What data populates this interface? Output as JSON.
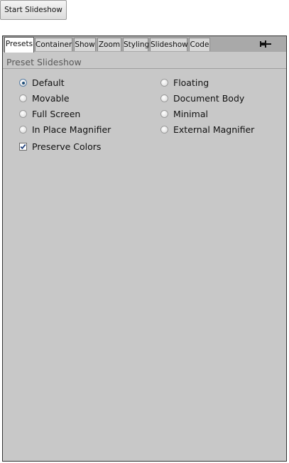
{
  "start_button": {
    "label": "Start Slideshow"
  },
  "tabs": [
    {
      "label": "Presets",
      "active": true
    },
    {
      "label": "Container",
      "active": false
    },
    {
      "label": "Show",
      "active": false
    },
    {
      "label": "Zoom",
      "active": false
    },
    {
      "label": "Styling",
      "active": false
    },
    {
      "label": "Slideshow",
      "active": false
    },
    {
      "label": "Code",
      "active": false
    }
  ],
  "pin_icon": "pin-icon",
  "section": {
    "title": "Preset Slideshow"
  },
  "presets": {
    "left": [
      {
        "label": "Default",
        "checked": true
      },
      {
        "label": "Movable",
        "checked": false
      },
      {
        "label": "Full Screen",
        "checked": false
      },
      {
        "label": "In Place Magnifier",
        "checked": false
      }
    ],
    "right": [
      {
        "label": "Floating",
        "checked": false
      },
      {
        "label": "Document Body",
        "checked": false
      },
      {
        "label": "Minimal",
        "checked": false
      },
      {
        "label": "External Magnifier",
        "checked": false
      }
    ]
  },
  "preserve_colors": {
    "label": "Preserve Colors",
    "checked": true
  },
  "colors": {
    "panel_bg": "#c8c8c8",
    "tabbar_bg": "#a9a9a9",
    "radio_dot": "#1f4e79",
    "check_mark": "#1f3f7a"
  }
}
